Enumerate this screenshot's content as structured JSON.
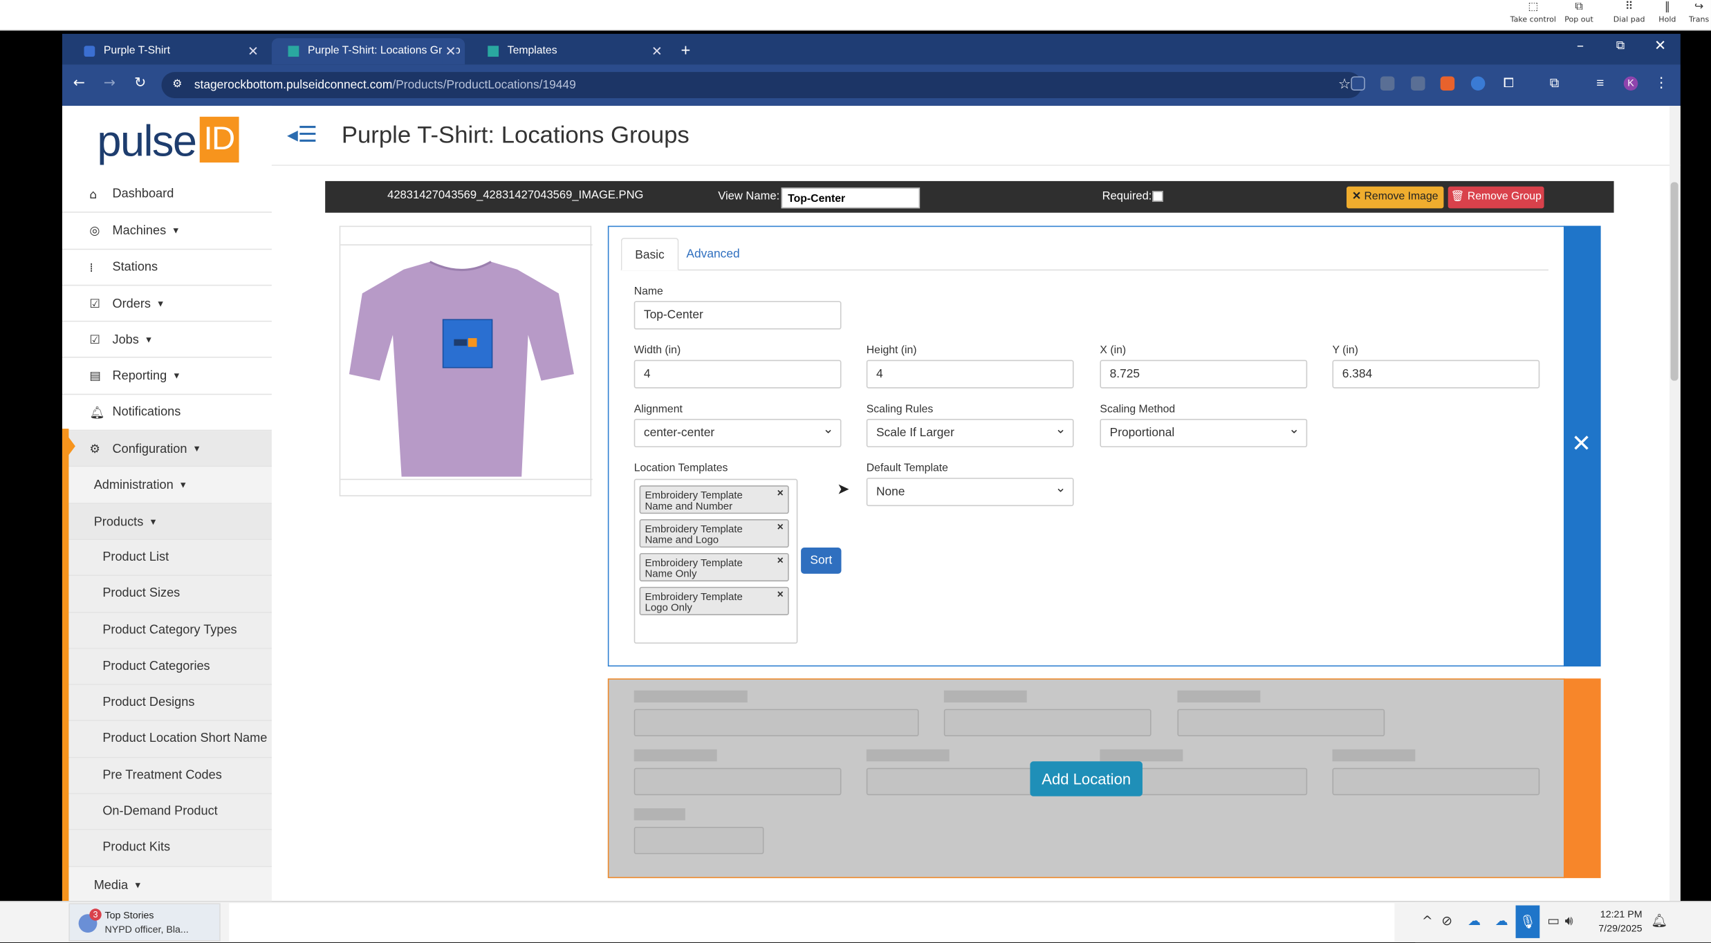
{
  "callbar": {
    "buttons": [
      {
        "label": "Take control",
        "icon": "take-control-icon"
      },
      {
        "label": "Pop out",
        "icon": "pop-out-icon"
      },
      {
        "label": "Dial pad",
        "icon": "dial-pad-icon"
      },
      {
        "label": "Hold",
        "icon": "hold-icon"
      },
      {
        "label": "Trans",
        "icon": "transfer-icon"
      }
    ]
  },
  "browser": {
    "tabs": [
      {
        "title": "Purple T-Shirt",
        "active": false
      },
      {
        "title": "Purple T-Shirt: Locations Group",
        "active": true
      },
      {
        "title": "Templates",
        "active": false
      }
    ],
    "url_domain": "stagerockbottom.pulseidconnect.com",
    "url_path": "/Products/ProductLocations/19449",
    "profile_initial": "K"
  },
  "sidebar": {
    "logo_text": "pulse",
    "logo_badge": "ID",
    "items": [
      {
        "label": "Dashboard",
        "icon": "home-icon",
        "caret": false
      },
      {
        "label": "Machines",
        "icon": "machine-icon",
        "caret": true
      },
      {
        "label": "Stations",
        "icon": "stations-icon",
        "caret": false
      },
      {
        "label": "Orders",
        "icon": "orders-icon",
        "caret": true
      },
      {
        "label": "Jobs",
        "icon": "jobs-icon",
        "caret": true
      },
      {
        "label": "Reporting",
        "icon": "reporting-icon",
        "caret": true
      },
      {
        "label": "Notifications",
        "icon": "bell-icon",
        "caret": false
      },
      {
        "label": "Configuration",
        "icon": "gear-icon",
        "caret": true
      }
    ],
    "sub1": [
      {
        "label": "Administration",
        "caret": true
      },
      {
        "label": "Products",
        "caret": true
      }
    ],
    "sub2": [
      "Product List",
      "Product Sizes",
      "Product Category Types",
      "Product Categories",
      "Product Designs",
      "Product Location Short Name",
      "Pre Treatment Codes",
      "On-Demand Product",
      "Product Kits"
    ],
    "media": {
      "label": "Media",
      "caret": true
    }
  },
  "header": {
    "title": "Purple T-Shirt: Locations Groups"
  },
  "group": {
    "image_name": "42831427043569_42831427043569_IMAGE.PNG",
    "view_name_label": "View Name:",
    "view_name_value": "Top-Center",
    "required_label": "Required:",
    "required_checked": false,
    "remove_image_label": "Remove Image",
    "remove_group_label": "Remove Group",
    "location_card": {
      "tabs": [
        "Basic",
        "Advanced"
      ],
      "name_label": "Name",
      "name_value": "Top-Center",
      "width_label": "Width (in)",
      "width_value": "4",
      "height_label": "Height (in)",
      "height_value": "4",
      "x_label": "X (in)",
      "x_value": "8.725",
      "y_label": "Y (in)",
      "y_value": "6.384",
      "alignment_label": "Alignment",
      "alignment_value": "center-center",
      "scaling_rules_label": "Scaling Rules",
      "scaling_rules_value": "Scale If Larger",
      "scaling_method_label": "Scaling Method",
      "scaling_method_value": "Proportional",
      "location_templates_label": "Location Templates",
      "templates": [
        {
          "line1": "Embroidery Template",
          "line2": "Name and Number"
        },
        {
          "line1": "Embroidery Template",
          "line2": "Name and Logo"
        },
        {
          "line1": "Embroidery Template",
          "line2": "Name Only"
        },
        {
          "line1": "Embroidery Template",
          "line2": "Logo Only"
        }
      ],
      "sort_label": "Sort",
      "default_template_label": "Default Template",
      "default_template_value": "None"
    },
    "add_location_label": "Add Location"
  },
  "taskbar": {
    "news_badge": "3",
    "news_title": "Top Stories",
    "news_subtitle": "NYPD officer, Bla...",
    "time": "12:21 PM",
    "date": "7/29/2025"
  },
  "colors": {
    "brand_navy": "#1e3d6e",
    "brand_orange": "#f7941d",
    "card_blue": "#1f75c9",
    "remove_image": "#f0ad2e",
    "remove_group": "#d9414b",
    "add_location": "#1f8fb8"
  }
}
